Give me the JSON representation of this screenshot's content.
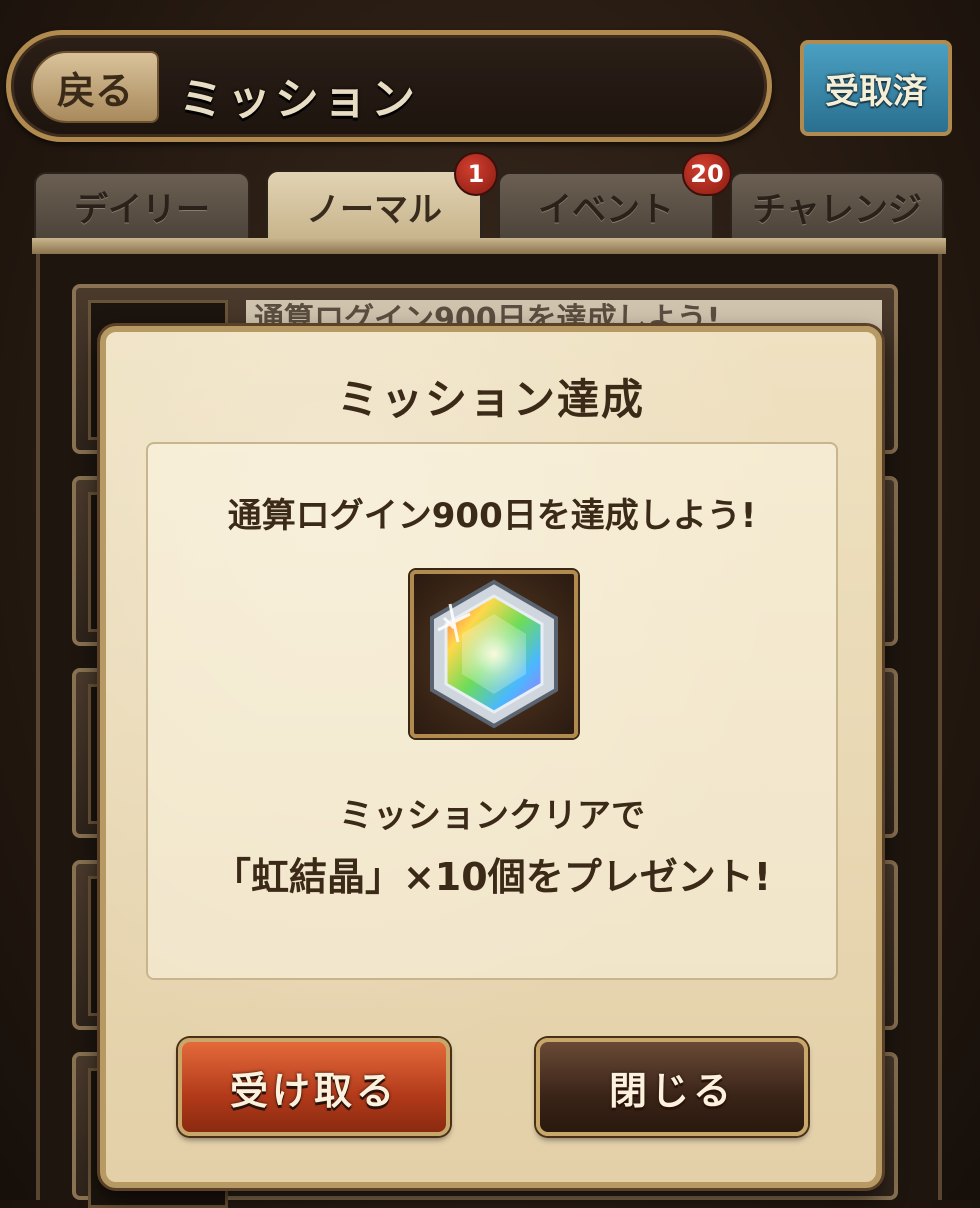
{
  "header": {
    "back_label": "戻る",
    "title": "ミッション",
    "received_label": "受取済"
  },
  "tabs": [
    {
      "label": "デイリー",
      "badge": ""
    },
    {
      "label": "ノーマル",
      "badge": "1"
    },
    {
      "label": "イベント",
      "badge": "20"
    },
    {
      "label": "チャレンジ",
      "badge": ""
    }
  ],
  "background_list": {
    "first_row_text": "通算ログイン900日を達成しよう!"
  },
  "dialog": {
    "title": "ミッション達成",
    "mission_text": "通算ログイン900日を達成しよう!",
    "reward_line1": "ミッションクリアで",
    "reward_line2": "「虹結晶」×10個をプレゼント!",
    "reward_icon": "rainbow-crystal-icon",
    "receive_label": "受け取る",
    "close_label": "閉じる"
  },
  "colors": {
    "badge": "#b3291c",
    "receive_button": "#c4461f",
    "close_button": "#3f281a",
    "received_button": "#3a88aa"
  }
}
